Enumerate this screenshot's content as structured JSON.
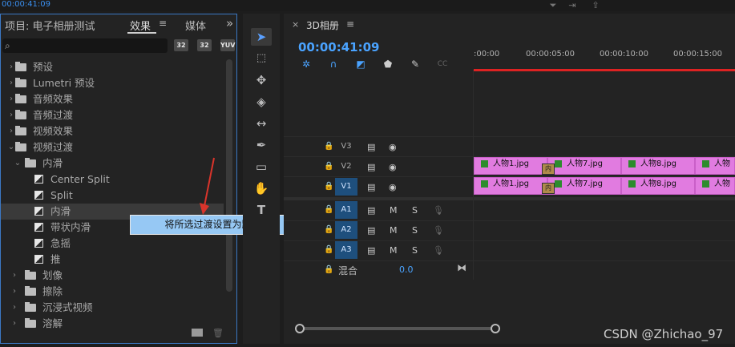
{
  "top": {
    "timecode": "00:00:41:09"
  },
  "left_panel": {
    "project_title": "项目: 电子相册测试",
    "tab_effects": "效果",
    "tab_menu": "≡",
    "tab_media": "媒体",
    "expand": "»",
    "badges": [
      "32",
      "32",
      "YUV"
    ],
    "tree": [
      {
        "label": "预设",
        "type": "folder",
        "expanded": false
      },
      {
        "label": "Lumetri 预设",
        "type": "folder",
        "expanded": false
      },
      {
        "label": "音频效果",
        "type": "folder",
        "expanded": false
      },
      {
        "label": "音频过渡",
        "type": "folder",
        "expanded": false
      },
      {
        "label": "视频效果",
        "type": "folder",
        "expanded": false
      },
      {
        "label": "视频过渡",
        "type": "folder",
        "expanded": true
      },
      {
        "label": "内滑",
        "type": "subfolder",
        "expanded": true
      },
      {
        "label": "Center Split",
        "type": "effect"
      },
      {
        "label": "Split",
        "type": "effect"
      },
      {
        "label": "内滑",
        "type": "effect",
        "selected": true
      },
      {
        "label": "带状内滑",
        "type": "effect"
      },
      {
        "label": "急摇",
        "type": "effect"
      },
      {
        "label": "推",
        "type": "effect"
      },
      {
        "label": "划像",
        "type": "subfolder",
        "expanded": false
      },
      {
        "label": "擦除",
        "type": "subfolder",
        "expanded": false
      },
      {
        "label": "沉浸式视频",
        "type": "subfolder",
        "expanded": false
      },
      {
        "label": "溶解",
        "type": "subfolder",
        "expanded": false
      }
    ],
    "context_menu_item": "将所选过渡设置为默认过渡"
  },
  "timeline": {
    "tab_close": "×",
    "tab_title": "3D相册",
    "tab_menu": "≡",
    "timecode": "00:00:41:09",
    "ruler_ticks": [
      ":00:00",
      "00:00:05:00",
      "00:00:10:00",
      "00:00:15:00"
    ],
    "video_tracks": [
      "V3",
      "V2",
      "V1"
    ],
    "audio_tracks": [
      "A1",
      "A2",
      "A3"
    ],
    "mix_label": "混合",
    "mix_value": "0.0",
    "m_label": "M",
    "s_label": "S",
    "transition_label": "内",
    "clips": [
      "人物1.jpg",
      "人物7.jpg",
      "人物8.jpg",
      "人物"
    ]
  },
  "watermark": "CSDN @Zhichao_97"
}
